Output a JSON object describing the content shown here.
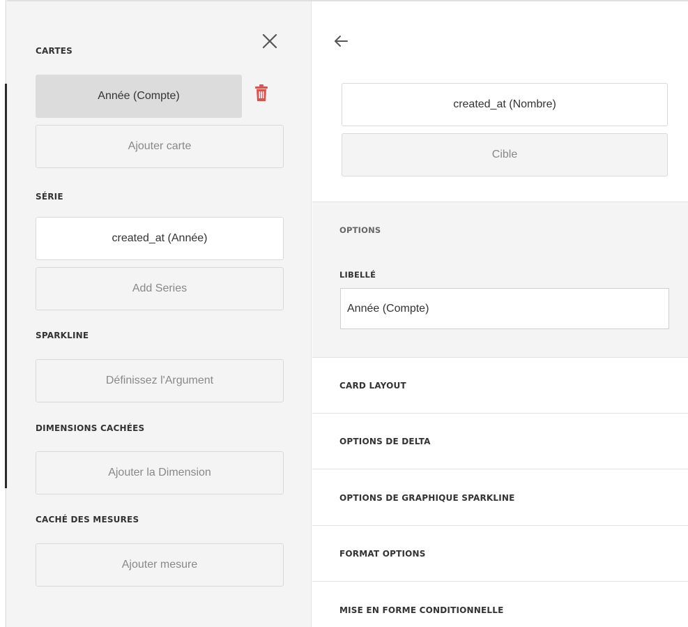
{
  "left_panel": {
    "cards": {
      "title": "CARTES",
      "selected_card": "Année (Compte)",
      "add_label": "Ajouter carte"
    },
    "series": {
      "title": "SÉRIE",
      "value": "created_at (Année)",
      "add_label": "Add Series"
    },
    "sparkline": {
      "title": "SPARKLINE",
      "placeholder": "Définissez l'Argument"
    },
    "hidden_dimensions": {
      "title": "DIMENSIONS CACHÉES",
      "add_label": "Ajouter la Dimension"
    },
    "hidden_measures": {
      "title": "CACHÉ DES MESURES",
      "add_label": "Ajouter mesure"
    },
    "icons": {
      "close": "close-icon",
      "delete": "trash-icon"
    },
    "colors": {
      "delete_icon": "#d9534f"
    }
  },
  "right_panel": {
    "back_icon": "arrow-left-icon",
    "actual_field": "created_at (Nombre)",
    "target_field": "Cible",
    "options": {
      "title": "OPTIONS",
      "label_title": "LIBELLÉ",
      "label_value": "Année (Compte)"
    },
    "sections": [
      {
        "label": "CARD LAYOUT"
      },
      {
        "label": "OPTIONS DE DELTA"
      },
      {
        "label": "OPTIONS DE GRAPHIQUE SPARKLINE"
      },
      {
        "label": "FORMAT OPTIONS"
      },
      {
        "label": "MISE EN FORME CONDITIONNELLE"
      }
    ]
  }
}
